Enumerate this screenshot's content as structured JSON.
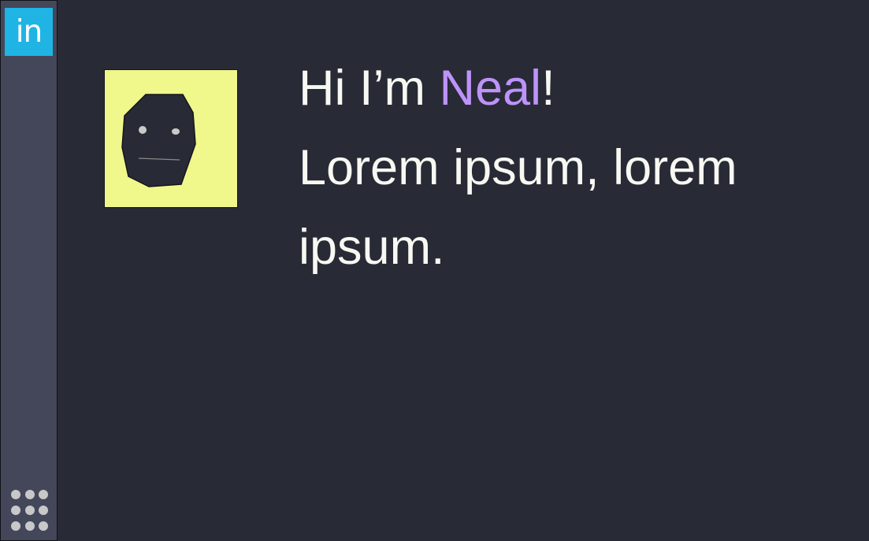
{
  "sidebar": {
    "linkedin": {
      "label": "in",
      "icon": "linkedin-icon",
      "color": "#1fb4e3"
    },
    "apps": {
      "icon": "apps-grid-icon"
    }
  },
  "avatar": {
    "icon": "face-icon",
    "background": "#f0f78b"
  },
  "hero": {
    "greeting_prefix": "Hi I’m ",
    "name": "Neal",
    "greeting_suffix": "!",
    "tagline": "Lorem ipsum, lorem ipsum."
  },
  "colors": {
    "background": "#282a36",
    "sidebar": "#44475a",
    "accent": "#bd93f9",
    "text": "#f8f8f2"
  }
}
